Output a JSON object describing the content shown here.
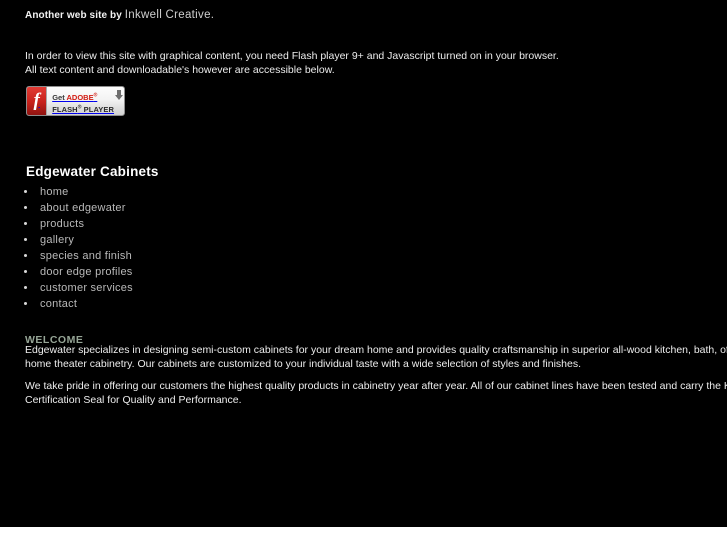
{
  "page": {
    "background_color": "#000000",
    "text_color": "#ededed",
    "accent_color": "#96a596",
    "link_color": "#b9b9b9"
  },
  "credit": {
    "prefix": "Another web site by ",
    "link_text": "Inkwell Creative.",
    "link_name": "inkwell-creative-link"
  },
  "notice": {
    "line1": "In order to view this site with graphical content, you need Flash player 9+ and Javascript turned on in your browser.",
    "line2": "All text content and downloadable's however are accessible below."
  },
  "flash_badge": {
    "icon_name": "flash-f-icon",
    "icon_glyph": "f",
    "get_label": "Get ",
    "adobe_label": "ADOBE",
    "adobe_sup": "®",
    "flash_label": "FLASH",
    "flash_sup": "®",
    "player_label": " PLAYER",
    "arrow_name": "download-arrow-icon",
    "brand_red": "#c6211b"
  },
  "site": {
    "title": "Edgewater Cabinets"
  },
  "nav": {
    "items": [
      {
        "label": "home",
        "name": "nav-item-home"
      },
      {
        "label": "about edgewater",
        "name": "nav-item-about-edgewater"
      },
      {
        "label": "products",
        "name": "nav-item-products"
      },
      {
        "label": "gallery",
        "name": "nav-item-gallery"
      },
      {
        "label": "species and finish",
        "name": "nav-item-species-and-finish"
      },
      {
        "label": "door edge profiles",
        "name": "nav-item-door-edge-profiles"
      },
      {
        "label": "customer services",
        "name": "nav-item-customer-services"
      },
      {
        "label": "contact",
        "name": "nav-item-contact"
      }
    ]
  },
  "welcome": {
    "heading": "WELCOME",
    "paragraph1_line1": "Edgewater specializes in designing semi-custom cabinets for your dream home and provides quality craftsmanship in superior all-wood kitchen, bath, office, and",
    "paragraph1_line2": "home theater cabinetry.  Our cabinets are customized to your individual taste with a wide selection of styles and finishes.",
    "paragraph2_line1": "We take pride in offering our customers the highest quality products in cabinetry year after year. All of our cabinet lines have been tested and carry the KCMA",
    "paragraph2_line2": "Certification Seal for Quality and Performance."
  }
}
